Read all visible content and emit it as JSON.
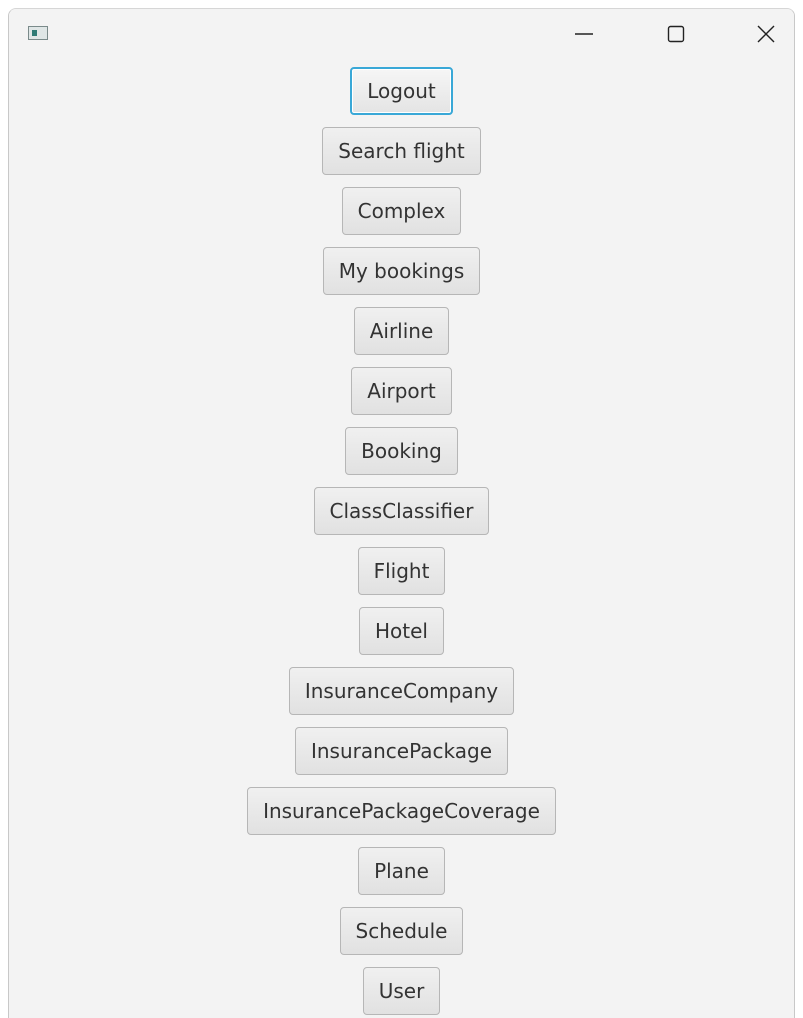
{
  "window": {
    "title_icon": "app-window-icon",
    "controls": {
      "minimize": "minimize-icon",
      "maximize": "maximize-icon",
      "close": "close-icon"
    }
  },
  "buttons": [
    {
      "label": "Logout",
      "name": "logout-button",
      "focused": true
    },
    {
      "label": "Search flight",
      "name": "search-flight-button"
    },
    {
      "label": "Complex",
      "name": "complex-button"
    },
    {
      "label": "My bookings",
      "name": "my-bookings-button"
    },
    {
      "label": "Airline",
      "name": "airline-button"
    },
    {
      "label": "Airport",
      "name": "airport-button"
    },
    {
      "label": "Booking",
      "name": "booking-button"
    },
    {
      "label": "ClassClassifier",
      "name": "class-classifier-button"
    },
    {
      "label": "Flight",
      "name": "flight-button"
    },
    {
      "label": "Hotel",
      "name": "hotel-button"
    },
    {
      "label": "InsuranceCompany",
      "name": "insurance-company-button"
    },
    {
      "label": "InsurancePackage",
      "name": "insurance-package-button"
    },
    {
      "label": "InsurancePackageCoverage",
      "name": "insurance-package-coverage-button"
    },
    {
      "label": "Plane",
      "name": "plane-button"
    },
    {
      "label": "Schedule",
      "name": "schedule-button"
    },
    {
      "label": "User",
      "name": "user-button"
    }
  ],
  "colors": {
    "background": "#f3f3f3",
    "button_border": "#b6b6b6",
    "focus_ring": "#39a8d7",
    "text": "#333333"
  }
}
